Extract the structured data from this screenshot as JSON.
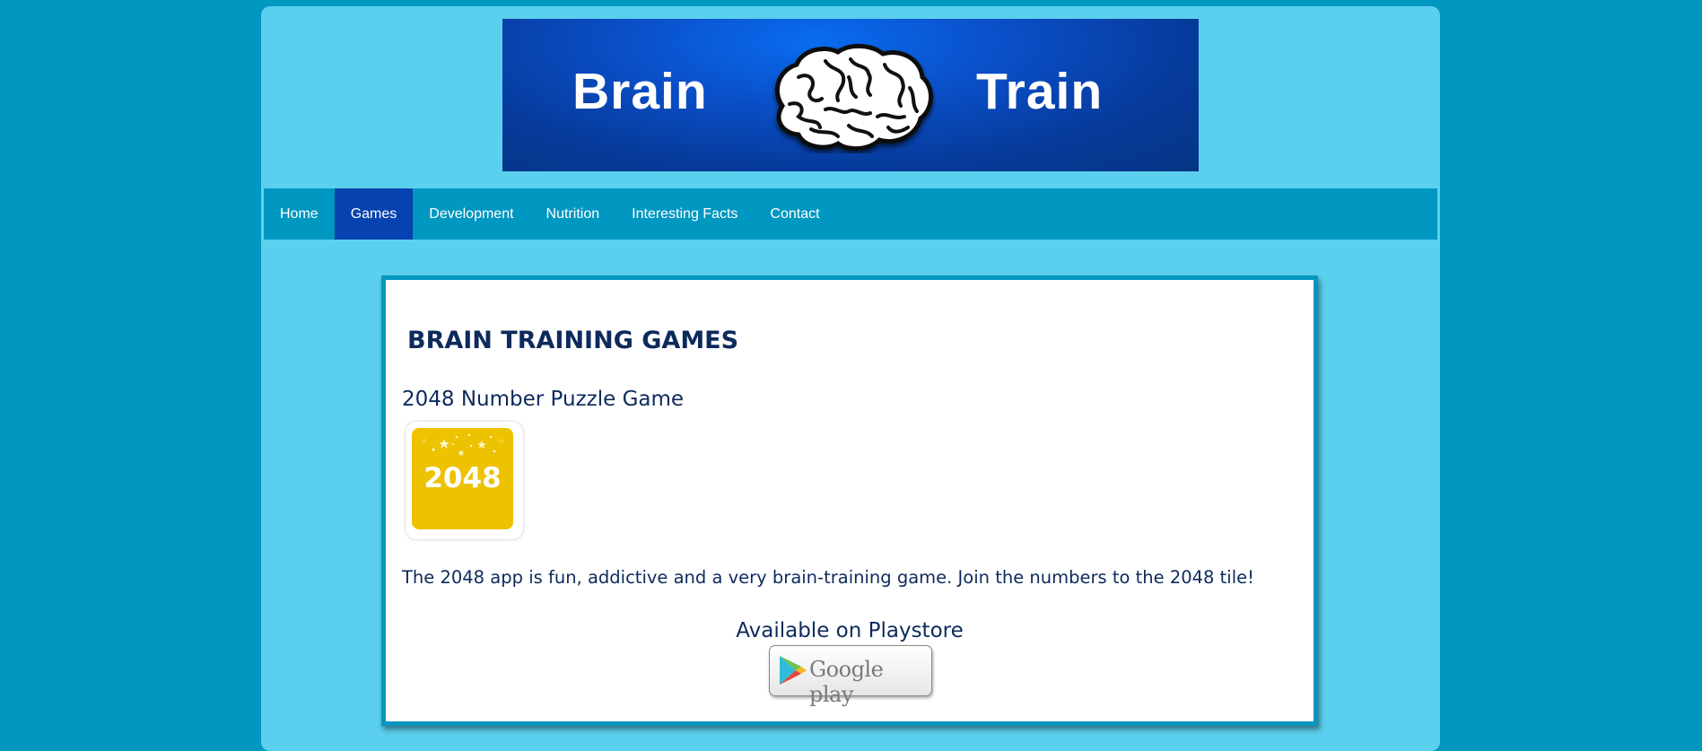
{
  "header": {
    "logo_word_left": "Brain",
    "logo_word_right": "Train",
    "logo_icon": "brain-icon"
  },
  "nav": {
    "items": [
      {
        "label": "Home",
        "active": false
      },
      {
        "label": "Games",
        "active": true
      },
      {
        "label": "Development",
        "active": false
      },
      {
        "label": "Nutrition",
        "active": false
      },
      {
        "label": "Interesting Facts",
        "active": false
      },
      {
        "label": "Contact",
        "active": false
      }
    ]
  },
  "main": {
    "title": "BRAIN TRAINING GAMES",
    "game": {
      "name": "2048 Number Puzzle Game",
      "icon_text": "2048",
      "description": "The 2048 app is fun, addictive and a very brain-training game. Join the numbers to the 2048 tile!",
      "available_text": "Available on Playstore",
      "store_badge_label": "Google play",
      "store_icon": "google-play-icon"
    }
  },
  "colors": {
    "background": "#0097c0",
    "page": "#5bd0ee",
    "nav_bar": "#0097c0",
    "nav_active": "#0642b0",
    "heading_text": "#0d2a5c",
    "app_icon": "#edc200"
  }
}
